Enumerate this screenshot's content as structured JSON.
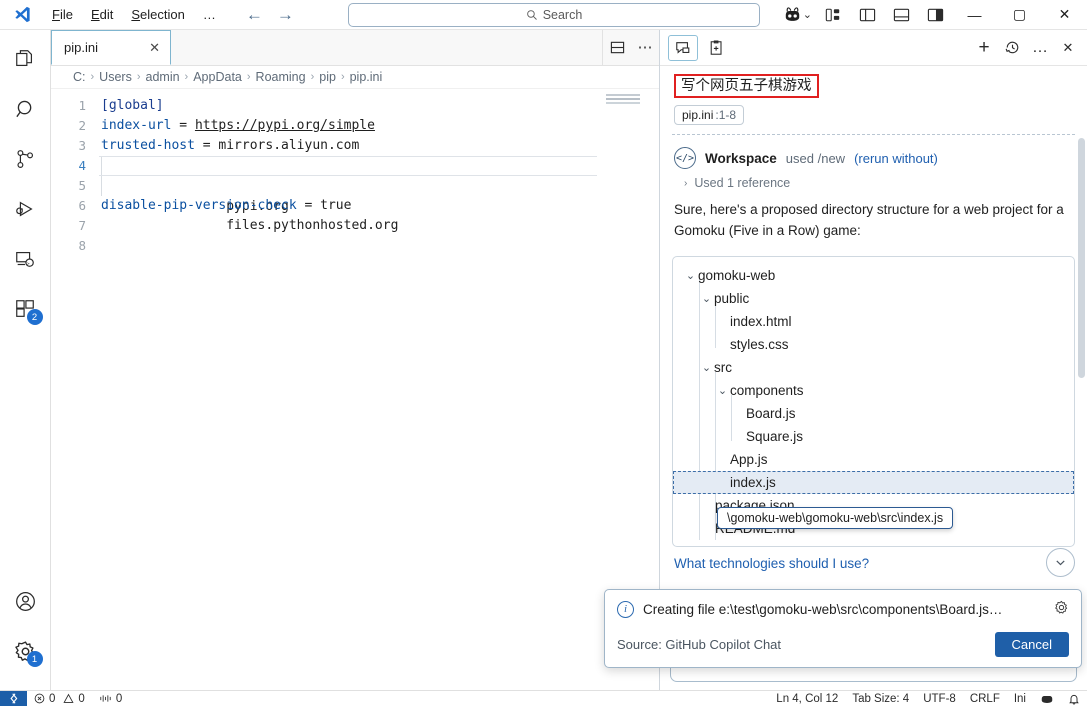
{
  "titlebar": {
    "logo": "vscode-logo",
    "menus": [
      {
        "label": "File",
        "accel": "F"
      },
      {
        "label": "Edit",
        "accel": "E"
      },
      {
        "label": "Selection",
        "accel": "S"
      },
      {
        "label": "…"
      }
    ],
    "nav_back": "←",
    "nav_forward": "→",
    "search_placeholder": "Search",
    "search_icon": "search-icon",
    "copilot_icon": "copilot-icon",
    "copilot_chevron": "⌄",
    "layout_buttons": [
      {
        "name": "customize-layout",
        "icon": "layout-customize-icon"
      },
      {
        "name": "toggle-primary-sidebar",
        "icon": "panel-left-icon"
      },
      {
        "name": "toggle-panel",
        "icon": "panel-bottom-icon"
      },
      {
        "name": "toggle-secondary-sidebar",
        "icon": "panel-right-icon"
      }
    ],
    "window_controls": {
      "minimize": "—",
      "maximize": "▢",
      "close": "✕"
    }
  },
  "activitybar": {
    "items": [
      {
        "name": "explorer",
        "icon": "files-icon",
        "badge": null
      },
      {
        "name": "search",
        "icon": "search-icon",
        "badge": null
      },
      {
        "name": "source-control",
        "icon": "source-control-icon",
        "badge": null
      },
      {
        "name": "run-and-debug",
        "icon": "debug-icon",
        "badge": null
      },
      {
        "name": "remote-explorer",
        "icon": "remote-explorer-icon",
        "badge": null
      },
      {
        "name": "extensions",
        "icon": "extensions-icon",
        "badge": "2"
      }
    ],
    "bottom": [
      {
        "name": "accounts",
        "icon": "account-icon",
        "badge": null
      },
      {
        "name": "manage-settings",
        "icon": "gear-icon",
        "badge": "1"
      }
    ]
  },
  "editor": {
    "tab": {
      "label": "pip.ini",
      "close": "✕"
    },
    "tab_actions": [
      {
        "name": "split-editor-down",
        "icon": "split-editor-icon"
      },
      {
        "name": "more-actions",
        "icon": "ellipsis-icon"
      }
    ],
    "breadcrumbs": [
      "C:",
      "Users",
      "admin",
      "AppData",
      "Roaming",
      "pip",
      "pip.ini"
    ],
    "breadcrumb_separator": "›",
    "line_numbers": [
      "1",
      "2",
      "3",
      "4",
      "5",
      "6",
      "7",
      "8"
    ],
    "active_line": 4,
    "lines": [
      {
        "n": 1,
        "segments": [
          {
            "t": "[global]",
            "c": "tok-sec"
          }
        ]
      },
      {
        "n": 2,
        "segments": [
          {
            "t": "index-url",
            "c": "tok-key"
          },
          {
            "t": " = ",
            "c": "tok-val"
          },
          {
            "t": "https://pypi.org/simple",
            "c": "tok-url"
          }
        ]
      },
      {
        "n": 3,
        "segments": [
          {
            "t": "trusted-host",
            "c": "tok-key"
          },
          {
            "t": " = ",
            "c": "tok-val"
          },
          {
            "t": "mirrors.aliyun.com",
            "c": "tok-val"
          }
        ]
      },
      {
        "n": 4,
        "segments": [
          {
            "t": "    pypi.org",
            "c": "tok-val"
          }
        ]
      },
      {
        "n": 5,
        "segments": [
          {
            "t": "    files.pythonhosted.org",
            "c": "tok-val"
          }
        ]
      },
      {
        "n": 6,
        "segments": [
          {
            "t": "disable-pip-version-check",
            "c": "tok-key"
          },
          {
            "t": " = ",
            "c": "tok-val"
          },
          {
            "t": "true",
            "c": "tok-val"
          }
        ]
      },
      {
        "n": 7,
        "segments": [
          {
            "t": "",
            "c": "tok-val"
          }
        ]
      },
      {
        "n": 8,
        "segments": [
          {
            "t": "",
            "c": "tok-val"
          }
        ]
      }
    ]
  },
  "chat": {
    "toolbar": {
      "chat_tab_icon": "chat-icon",
      "edits_tab_icon": "new-edit-session-icon",
      "new_chat": "+",
      "history_icon": "history-icon",
      "more_icon": "…",
      "close_icon": "✕"
    },
    "user_message": "写个网页五子棋游戏",
    "context_chip": {
      "file": "pip.ini",
      "range": ":1-8"
    },
    "agent": {
      "badge_icon": "code-icon",
      "name": "Workspace",
      "used_text": "used /new",
      "rerun_link": "(rerun without)"
    },
    "references": {
      "chevron": "›",
      "label": "Used 1 reference"
    },
    "response_paragraph": "Sure, here's a proposed directory structure for a web project for a Gomoku (Five in a Row) game:",
    "tree": [
      {
        "label": "gomoku-web",
        "depth": 0,
        "twisty": "⌄",
        "selected": false
      },
      {
        "label": "public",
        "depth": 1,
        "twisty": "⌄",
        "selected": false
      },
      {
        "label": "index.html",
        "depth": 2,
        "twisty": "",
        "selected": false
      },
      {
        "label": "styles.css",
        "depth": 2,
        "twisty": "",
        "selected": false
      },
      {
        "label": "src",
        "depth": 1,
        "twisty": "⌄",
        "selected": false
      },
      {
        "label": "components",
        "depth": 2,
        "twisty": "⌄",
        "selected": false
      },
      {
        "label": "Board.js",
        "depth": 3,
        "twisty": "",
        "selected": false
      },
      {
        "label": "Square.js",
        "depth": 3,
        "twisty": "",
        "selected": false
      },
      {
        "label": "App.js",
        "depth": 2,
        "twisty": "",
        "selected": false
      },
      {
        "label": "index.js",
        "depth": 2,
        "twisty": "",
        "selected": true
      },
      {
        "label": "package.json",
        "depth": 1,
        "twisty": "",
        "selected": false
      },
      {
        "label": "README.md",
        "depth": 1,
        "twisty": "",
        "selected": false
      }
    ],
    "tooltip": "\\gomoku-web\\gomoku-web\\src\\index.js",
    "scroll_down_icon": "chevron-down-icon",
    "followup": "What technologies should I use?",
    "input_placeholder": ""
  },
  "toast": {
    "info_icon": "info-icon",
    "message": "Creating file e:\\test\\gomoku-web\\src\\components\\Board.js…",
    "gear_icon": "gear-icon",
    "source": "Source: GitHub Copilot Chat",
    "cancel_label": "Cancel"
  },
  "statusbar": {
    "remote_icon": "remote-indicator-icon",
    "left_items": [
      {
        "name": "problems",
        "text": "0",
        "icon": "error-icon"
      },
      {
        "name": "warnings",
        "text": "0",
        "icon": "warning-icon"
      },
      {
        "name": "ports",
        "text": "0",
        "icon": "ports-icon"
      }
    ],
    "right_items": [
      {
        "name": "cursor-position",
        "text": "Ln 4, Col 12"
      },
      {
        "name": "indentation",
        "text": "Tab Size: 4"
      },
      {
        "name": "encoding",
        "text": "UTF-8"
      },
      {
        "name": "eol",
        "text": "CRLF"
      },
      {
        "name": "language-mode",
        "text": "Ini"
      },
      {
        "name": "copilot-status",
        "text": "",
        "icon": "copilot-icon"
      },
      {
        "name": "notifications",
        "text": "",
        "icon": "bell-icon"
      }
    ]
  },
  "colors": {
    "accent": "#1f5fa8",
    "highlight_red": "#e02020",
    "link": "#2060b0",
    "badge": "#1f6fd0"
  }
}
